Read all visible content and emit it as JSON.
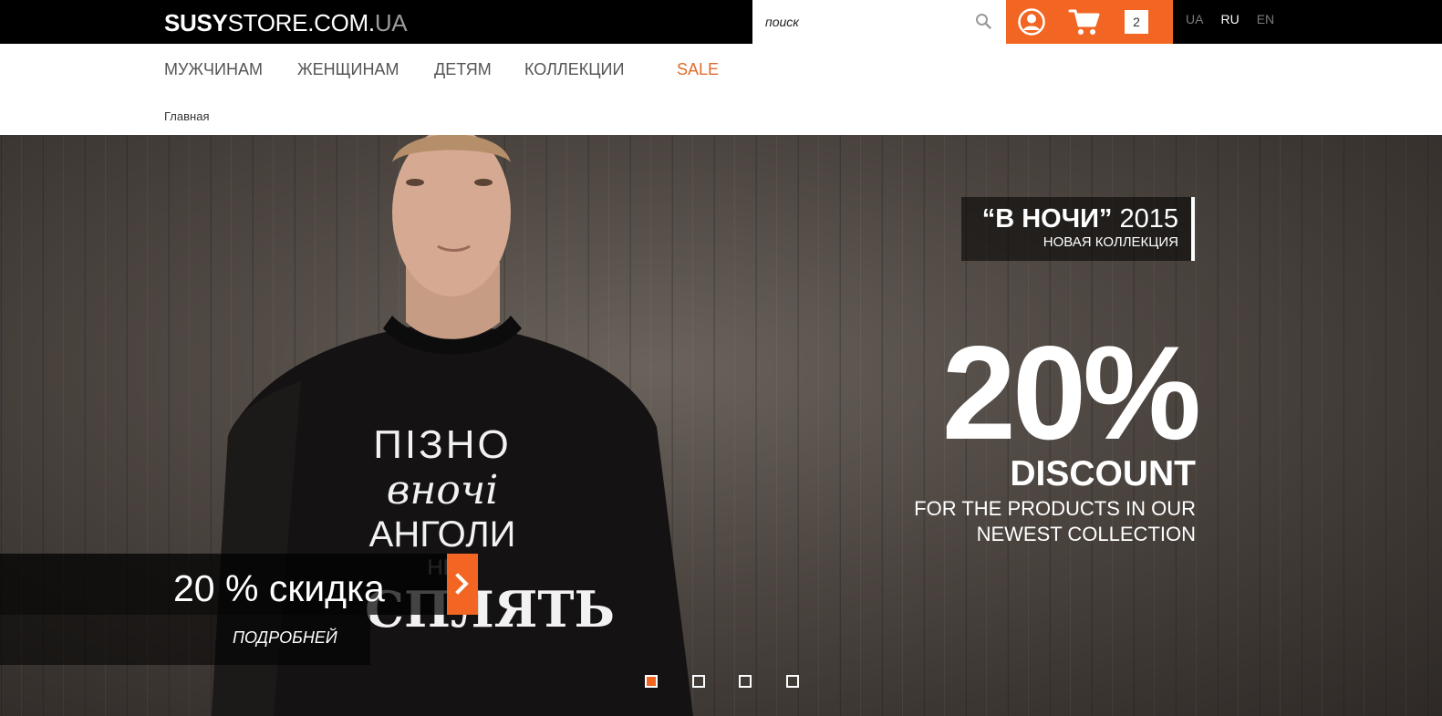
{
  "header": {
    "logo_bold": "SUSY",
    "logo_light": "STORE.COM.",
    "logo_suffix": "UA",
    "search_placeholder": "поиск",
    "cart_count": "2",
    "languages": [
      "UA",
      "RU",
      "EN"
    ],
    "active_language": "RU"
  },
  "nav": {
    "items": [
      "МУЖЧИНАМ",
      "ЖЕНЩИНАМ",
      "ДЕТЯМ",
      "КОЛЛЕКЦИИ",
      "SALE"
    ]
  },
  "breadcrumb": "Главная",
  "hero": {
    "collection_title_bold": "“В НОЧИ”",
    "collection_year": "2015",
    "collection_subtitle": "НОВАЯ КОЛЛЕКЦИЯ",
    "discount_percent": "20%",
    "discount_label": "DISCOUNT",
    "discount_text_line1": "FOR THE PRODUCTS IN OUR",
    "discount_text_line2": "NEWEST COLLECTION",
    "shirt_text": [
      "ПІЗНО",
      "вночі",
      "АНГОЛИ",
      "НЕ",
      "СПЛЯТЬ"
    ],
    "promo_text": "20 % скидка",
    "more_link": "ПОДРОБНЕЙ",
    "slides_total": 4,
    "active_slide": 1
  },
  "colors": {
    "accent": "#f26522",
    "topbar": "#000000"
  }
}
